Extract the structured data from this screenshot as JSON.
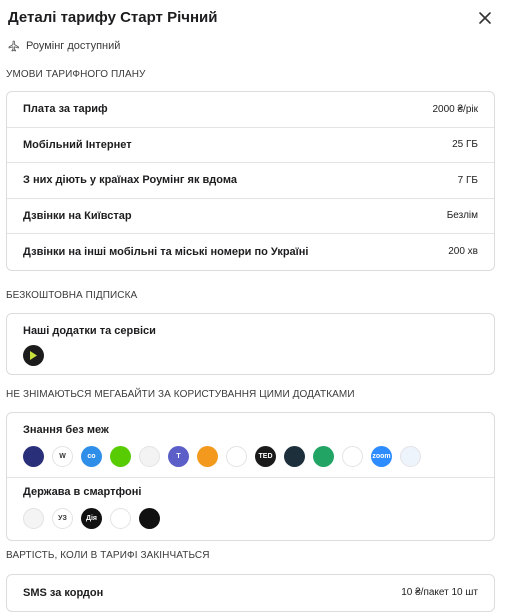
{
  "header": {
    "title": "Деталі тарифу Старт Річний"
  },
  "roaming": {
    "label": "Роумінг доступний"
  },
  "sections": {
    "conditions": "УМОВИ ТАРИФНОГО ПЛАНУ",
    "free_sub": "БЕЗКОШТОВНА ПІДПИСКА",
    "no_mb": "НЕ ЗНІМАЮТЬСЯ МЕГАБАЙТИ ЗА КОРИСТУВАННЯ ЦИМИ ДОДАТКАМИ",
    "after_end": "ВАРТІСТЬ, КОЛИ В ТАРИФІ ЗАКІНЧАТЬСЯ"
  },
  "conditions": [
    {
      "label": "Плата за тариф",
      "value": "2000 ₴/рік"
    },
    {
      "label": "Мобільний Інтернет",
      "value": "25 ГБ"
    },
    {
      "label": "З них діють у країнах Роумінг як вдома",
      "value": "7 ГБ"
    },
    {
      "label": "Дзвінки на Київстар",
      "value": "Безлім"
    },
    {
      "label": "Дзвінки на інші мобільні та міські номери по Україні",
      "value": "200 хв"
    }
  ],
  "free_sub": {
    "label": "Наші додатки та сервіси"
  },
  "apps": {
    "knowledge_label": "Знання без меж",
    "knowledge": [
      {
        "icon": "prometheus-icon",
        "text": "",
        "color": "#2a2f7a"
      },
      {
        "icon": "wikipedia-icon",
        "text": "W",
        "color": "#ffffff"
      },
      {
        "icon": "coursera-icon",
        "text": "co",
        "color": "#2f8fe8"
      },
      {
        "icon": "duolingo-icon",
        "text": "",
        "color": "#58cc02"
      },
      {
        "icon": "lightbulb-icon",
        "text": "",
        "color": "#f3f3f3"
      },
      {
        "icon": "teams-icon",
        "text": "T",
        "color": "#5b5fc7"
      },
      {
        "icon": "audible-icon",
        "text": "",
        "color": "#f39a1e"
      },
      {
        "icon": "google-photos-icon",
        "text": "",
        "color": "#ffffff"
      },
      {
        "icon": "ted-icon",
        "text": "TED",
        "color": "#1a1a1a"
      },
      {
        "icon": "ukrainer-icon",
        "text": "",
        "color": "#1c2f3a"
      },
      {
        "icon": "google-classroom-icon",
        "text": "",
        "color": "#21a464"
      },
      {
        "icon": "google-meet-icon",
        "text": "",
        "color": "#ffffff"
      },
      {
        "icon": "zoom-icon",
        "text": "zoom",
        "color": "#2d8cff"
      },
      {
        "icon": "reader-icon",
        "text": "",
        "color": "#eef4fb"
      }
    ],
    "state_label": "Держава в смартфоні",
    "state": [
      {
        "icon": "gov-portal-icon",
        "text": "",
        "color": "#f4f4f4"
      },
      {
        "icon": "ukrzaliznytsia-icon",
        "text": "УЗ",
        "color": "#ffffff"
      },
      {
        "icon": "diia-icon",
        "text": "Дія",
        "color": "#111111"
      },
      {
        "icon": "cloud-icon",
        "text": "",
        "color": "#ffffff"
      },
      {
        "icon": "info-icon",
        "text": "",
        "color": "#111111"
      }
    ]
  },
  "after_end": [
    {
      "label": "SMS за кордон",
      "value": "10 ₴/пакет 10 шт"
    }
  ]
}
